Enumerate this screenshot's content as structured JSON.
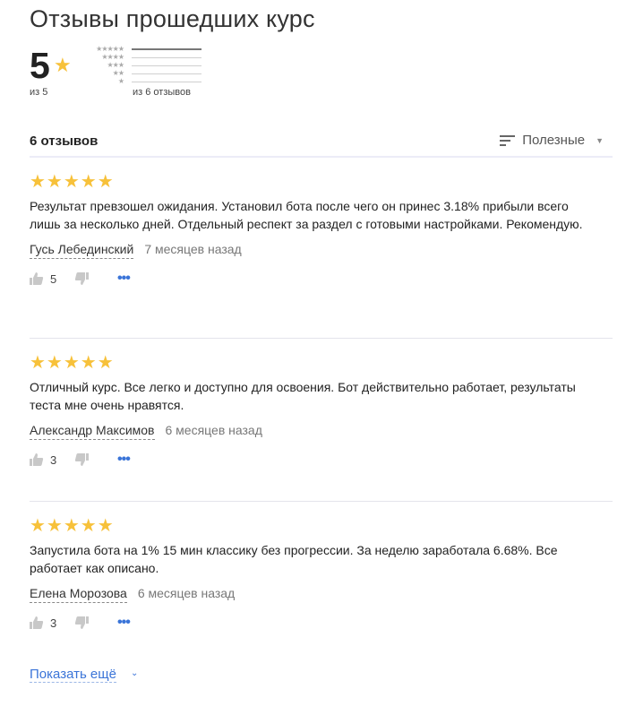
{
  "page": {
    "title": "Отзывы прошедших курс"
  },
  "summary": {
    "score": "5",
    "score_star": "★",
    "score_of": "из 5",
    "total_reviews": "из 6 отзывов",
    "distribution": [
      {
        "stars": "★★★★★",
        "share": 1.0
      },
      {
        "stars": "★★★★",
        "share": 0
      },
      {
        "stars": "★★★",
        "share": 0
      },
      {
        "stars": "★★",
        "share": 0
      },
      {
        "stars": "★",
        "share": 0
      }
    ]
  },
  "list": {
    "count_label": "6 отзывов",
    "sort_label": "Полезные",
    "sort_caret": "▼"
  },
  "reviews": [
    {
      "stars": "★★★★★",
      "text": "Результат превзошел ожидания. Установил бота после чего он принес 3.18% прибыли всего лишь за несколько дней. Отдельный респект за раздел с готовыми настройками. Рекомендую.",
      "author": "Гусь Лебединский",
      "date": "7 месяцев назад",
      "likes": "5",
      "more": "•••"
    },
    {
      "stars": "★★★★★",
      "text": "Отличный курс. Все легко и доступно для освоения. Бот действительно работает, результаты теста мне очень нравятся.",
      "author": "Александр Максимов",
      "date": "6 месяцев назад",
      "likes": "3",
      "more": "•••"
    },
    {
      "stars": "★★★★★",
      "text": "Запустила бота на 1% 15 мин классику без прогрессии. За неделю заработала 6.68%. Все работает как описано.",
      "author": "Елена Морозова",
      "date": "6 месяцев назад",
      "likes": "3",
      "more": "•••"
    }
  ],
  "footer": {
    "show_more_label": "Показать ещё",
    "show_more_caret": "⌄"
  },
  "colors": {
    "star": "#f7c13a",
    "link": "#3a74d8",
    "icon": "#c8c8c8"
  }
}
